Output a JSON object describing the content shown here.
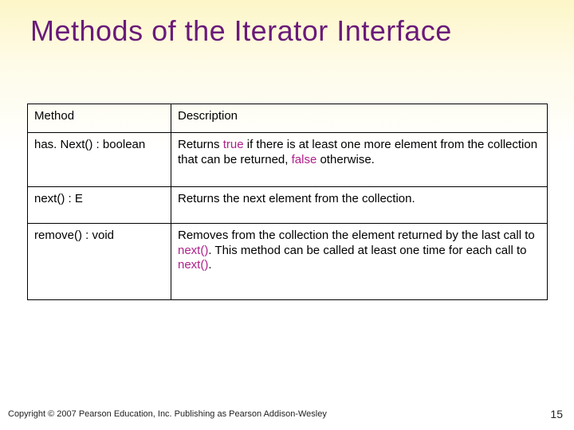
{
  "title": "Methods of the Iterator Interface",
  "headers": {
    "method": "Method",
    "description": "Description"
  },
  "rows": {
    "hasNext": {
      "method": "has. Next() : boolean",
      "desc_a": "Returns ",
      "desc_b": "true",
      "desc_c": " if there is at least one more element from the collection that can be returned, ",
      "desc_d": "false",
      "desc_e": " otherwise."
    },
    "next": {
      "method": "next() : E",
      "desc": "Returns the next element from the collection."
    },
    "remove": {
      "method": "remove() : void",
      "desc_a": "Removes from the collection the element returned by the last call to ",
      "desc_b": "next()",
      "desc_c": ". This method can be called at least one time for each call to ",
      "desc_d": "next()",
      "desc_e": "."
    }
  },
  "footer": "Copyright © 2007 Pearson Education, Inc. Publishing as Pearson Addison-Wesley",
  "page_number": "15",
  "chart_data": {
    "type": "table",
    "columns": [
      "Method",
      "Description"
    ],
    "rows": [
      [
        "has. Next() : boolean",
        "Returns true if there is at least one more element from the collection that can be returned, false otherwise."
      ],
      [
        "next() : E",
        "Returns the next element from the collection."
      ],
      [
        "remove() : void",
        "Removes from the collection the element returned by the last call to next(). This method can be called at least one time for each call to next()."
      ]
    ]
  }
}
